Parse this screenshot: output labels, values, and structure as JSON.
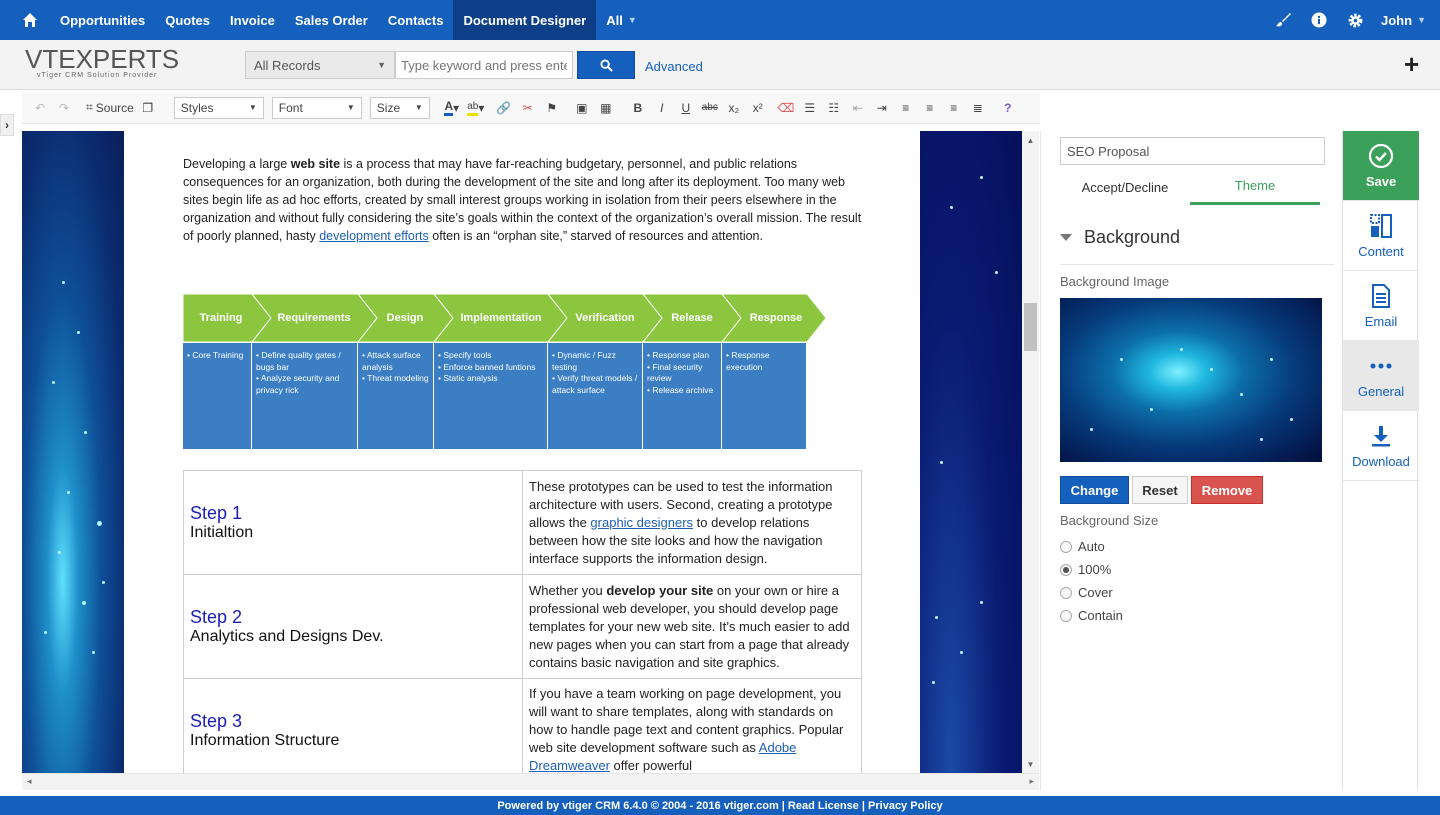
{
  "topnav": {
    "items": [
      "Opportunities",
      "Quotes",
      "Invoice",
      "Sales Order",
      "Contacts",
      "Document Designer",
      "All"
    ],
    "active": "Document Designer",
    "user": "John"
  },
  "header": {
    "logo_main": "VTEXPERTS",
    "logo_sub": "vTiger CRM Solution Provider",
    "records_filter": "All Records",
    "search_placeholder": "Type keyword and press enter",
    "advanced_label": "Advanced"
  },
  "toolbar": {
    "source_label": "Source",
    "styles_label": "Styles",
    "font_label": "Font",
    "size_label": "Size"
  },
  "document": {
    "intro": {
      "p1": "Developing a large ",
      "b1": "web site",
      "p2": " is a process that may have far-reaching budgetary, personnel, and public relations consequences for an organization, both during the development of the site and long after its deployment. Too many web sites begin life as ad hoc efforts, created by small interest groups working in isolation from their peers elsewhere in the organization and without fully considering the site’s goals within the context of the organization’s overall mission. The result of poorly planned, hasty ",
      "link": "development efforts",
      "p3": " often is an “orphan site,” starved of resources and attention."
    },
    "sdl_phases": [
      {
        "name": "Training",
        "details": "• Core Training"
      },
      {
        "name": "Requirements",
        "details": "• Define quality gates / bugs bar\n• Analyze security and privacy rick"
      },
      {
        "name": "Design",
        "details": "• Attack surface analysis\n• Threat modeling"
      },
      {
        "name": "Implementation",
        "details": "• Specify tools\n• Enforce banned funtions\n• Static analysis"
      },
      {
        "name": "Verification",
        "details": "• Dynamic / Fuzz testing\n• Verify threat models / attack surface"
      },
      {
        "name": "Release",
        "details": "• Response plan\n• Final security review\n• Release archive"
      },
      {
        "name": "Response",
        "details": "• Response execution"
      }
    ],
    "steps": [
      {
        "num": "Step 1",
        "title": "Initialtion",
        "text_a": "These prototypes can be used to test the information architecture with users. Second, creating a prototype allows the ",
        "link": "graphic designers",
        "text_b": " to develop relations between how the site looks and how the navigation interface supports the information design."
      },
      {
        "num": "Step 2",
        "title": "Analytics and Designs Dev.",
        "text_a": "Whether you ",
        "bold": "develop your site",
        "text_b": " on your own or hire a professional web developer, you should develop page templates for your new web site. It’s much easier to add new pages when you can start from a page that already contains basic navigation and site graphics."
      },
      {
        "num": "Step 3",
        "title": "Information Structure",
        "text_a": "If you have a team working on page development, you will want to share templates, along with standards on how to handle page text and content graphics. Popular web site development software such as ",
        "link": "Adobe Dreamweaver",
        "text_b": " offer powerful"
      }
    ]
  },
  "panel": {
    "doc_name": "SEO Proposal",
    "tabs": [
      "Accept/Decline",
      "Theme"
    ],
    "active_tab": "Theme",
    "section_title": "Background",
    "bg_image_label": "Background Image",
    "buttons": {
      "change": "Change",
      "reset": "Reset",
      "remove": "Remove"
    },
    "bg_size_label": "Background Size",
    "bg_size_options": [
      "Auto",
      "100%",
      "Cover",
      "Contain"
    ],
    "bg_size_selected": "100%"
  },
  "sidebar": {
    "items": [
      "Save",
      "Content",
      "Email",
      "General",
      "Download"
    ],
    "selected": "General"
  },
  "footer": {
    "text": "Powered by vtiger CRM 6.4.0  © 2004 - 2016  vtiger.com | Read License | Privacy Policy"
  },
  "colors": {
    "nav_blue": "#1560bd",
    "nav_active": "#0c3f88",
    "save_green": "#3ba05a",
    "remove_red": "#d9534f",
    "step_blue": "#1d1db5",
    "sdl_green": "#8cc63f",
    "sdl_blue": "#3c7ec4"
  }
}
